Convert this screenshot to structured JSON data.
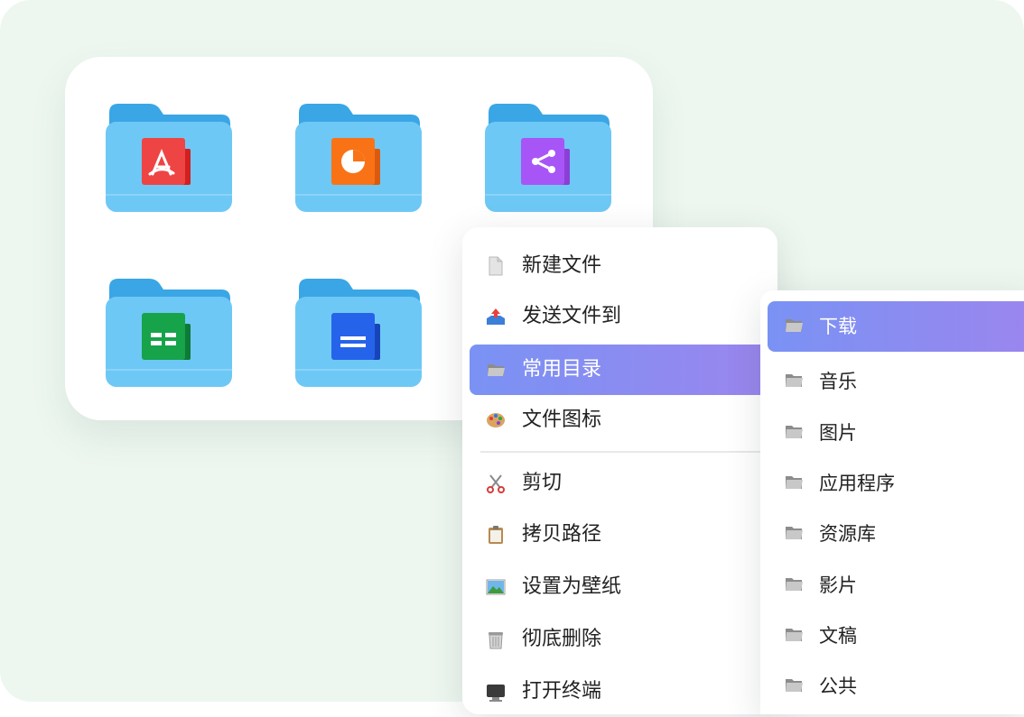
{
  "folders": [
    {
      "icon": "pdf-icon",
      "color": "#ef4444"
    },
    {
      "icon": "pie-chart-icon",
      "color": "#f97316"
    },
    {
      "icon": "share-icon",
      "color": "#a855f7"
    },
    {
      "icon": "spreadsheet-icon",
      "color": "#16a34a"
    },
    {
      "icon": "document-icon",
      "color": "#2563eb"
    }
  ],
  "context_menu": {
    "items": [
      {
        "label": "新建文件",
        "icon": "new-file-icon"
      },
      {
        "label": "发送文件到",
        "icon": "send-tray-icon"
      },
      {
        "label": "常用目录",
        "icon": "folder-icon",
        "active": true
      },
      {
        "label": "文件图标",
        "icon": "palette-icon"
      },
      {
        "label": "剪切",
        "icon": "scissors-icon"
      },
      {
        "label": "拷贝路径",
        "icon": "clipboard-icon"
      },
      {
        "label": "设置为壁纸",
        "icon": "wallpaper-icon"
      },
      {
        "label": "彻底删除",
        "icon": "trash-icon"
      },
      {
        "label": "打开终端",
        "icon": "terminal-icon"
      }
    ]
  },
  "submenu": {
    "items": [
      {
        "label": "下载",
        "active": true
      },
      {
        "label": "音乐"
      },
      {
        "label": "图片"
      },
      {
        "label": "应用程序"
      },
      {
        "label": "资源库"
      },
      {
        "label": "影片"
      },
      {
        "label": "文稿"
      },
      {
        "label": "公共"
      }
    ]
  },
  "colors": {
    "background": "#edf7f0",
    "folder_body": "#6ec8f5",
    "folder_back": "#3aa6e6",
    "menu_active_start": "#7a92f4",
    "menu_active_end": "#9a86ee"
  }
}
